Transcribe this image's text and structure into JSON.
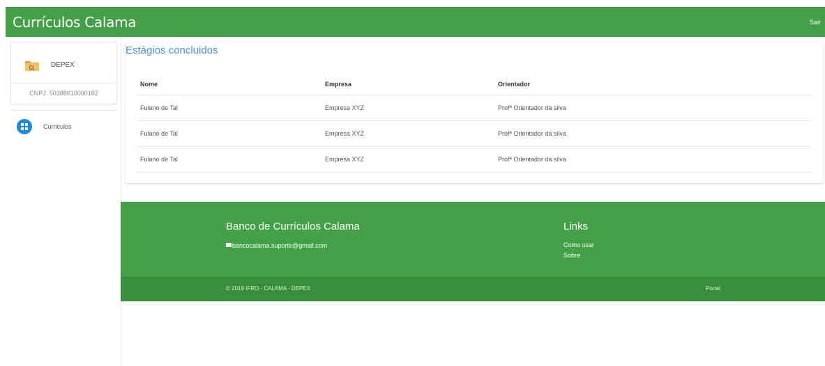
{
  "header": {
    "brand": "Currículos Calama",
    "logout": "Sair"
  },
  "sidebar": {
    "profile": {
      "name": "DEPEX",
      "cnpj": "CNPJ: 50388610000182",
      "icon": "folder-icon"
    },
    "menu": [
      {
        "label": "Curriculos",
        "icon": "grid-icon"
      }
    ]
  },
  "main": {
    "title": "Estágios concluidos",
    "table": {
      "headers": [
        "Nome",
        "Empresa",
        "Orientador"
      ],
      "rows": [
        [
          "Fulano de Tal",
          "Empresa XYZ",
          "Profª Orientador da silva"
        ],
        [
          "Fulano de Tal",
          "Empresa XYZ",
          "Profª Orientador da silva"
        ],
        [
          "Fulano de Tal",
          "Empresa XYZ",
          "Profª Orientador da silva"
        ]
      ]
    }
  },
  "footer": {
    "title": "Banco de Currículos Calama",
    "email": "bancocalama.suporte@gmail.com",
    "links_title": "Links",
    "links": [
      "Como usar",
      "Sobre"
    ],
    "copyright": "© 2019 IFRO - CALAMA - DEPEX",
    "portal": "Portal"
  },
  "colors": {
    "primary": "#43a047",
    "primary_dark": "#388e3c",
    "accent_blue": "#1e88e5",
    "title_blue": "#4a90d9"
  }
}
